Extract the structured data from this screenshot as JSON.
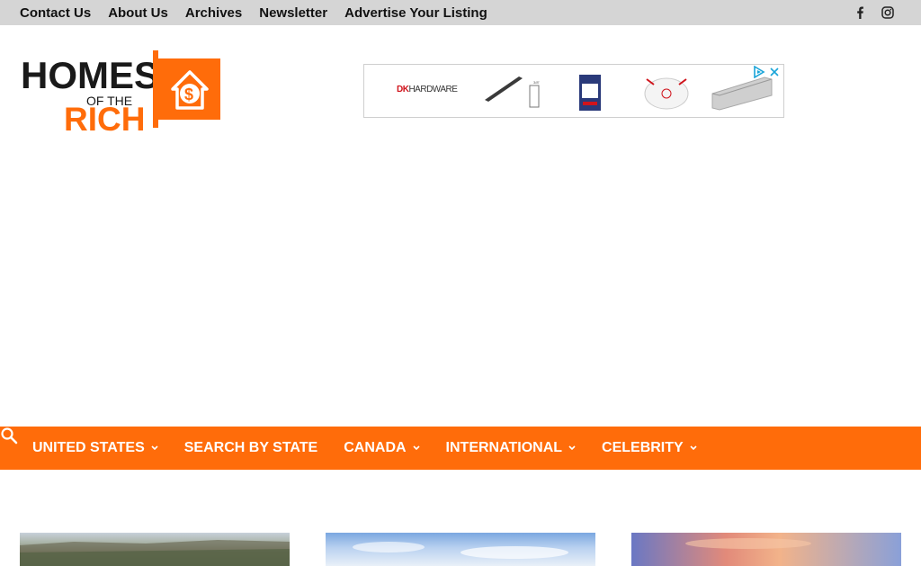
{
  "topbar": {
    "links": [
      "Contact Us",
      "About Us",
      "Archives",
      "Newsletter",
      "Advertise Your Listing"
    ],
    "social": [
      "facebook-icon",
      "instagram-icon"
    ]
  },
  "logo": {
    "line1": "HOMES",
    "line2": "OF THE",
    "line3": "RICH",
    "symbol": "$",
    "accent": "#ff6c0a"
  },
  "ad": {
    "brand_dk": "DK",
    "brand_rest": "HARDWARE"
  },
  "nav": {
    "items": [
      {
        "label": "UNITED STATES",
        "dropdown": true
      },
      {
        "label": "SEARCH BY STATE",
        "dropdown": false
      },
      {
        "label": "CANADA",
        "dropdown": true
      },
      {
        "label": "INTERNATIONAL",
        "dropdown": true
      },
      {
        "label": "CELEBRITY",
        "dropdown": true
      }
    ],
    "background": "#ff6c0a",
    "search_icon": "search-icon"
  }
}
